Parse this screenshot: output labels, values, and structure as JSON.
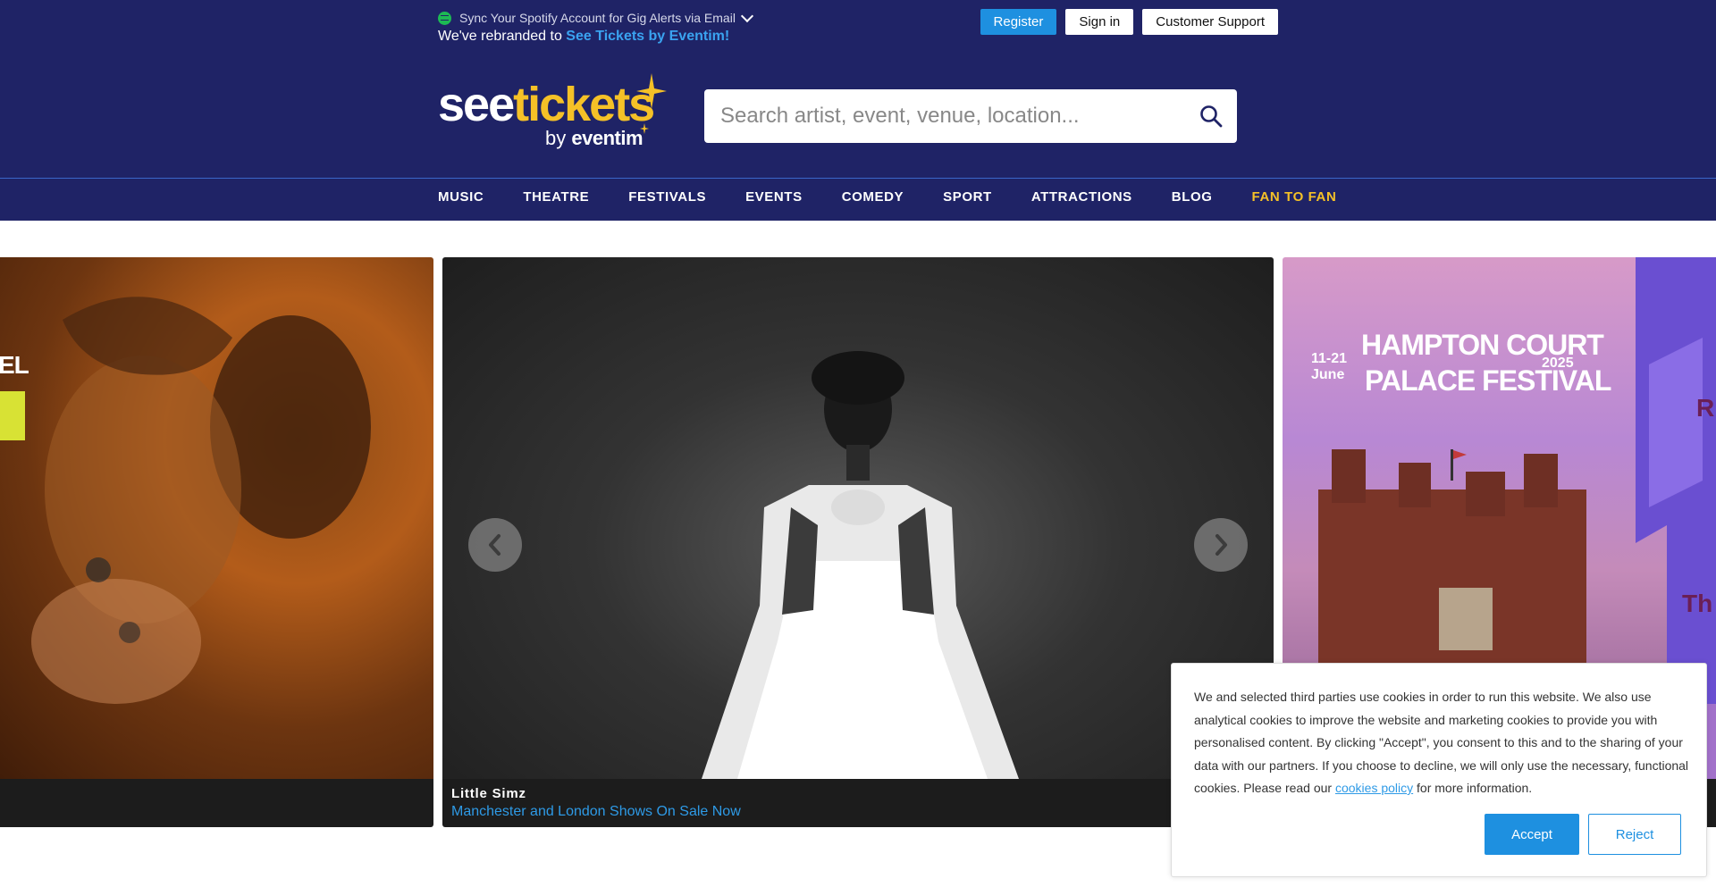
{
  "topbar": {
    "spotify_text": "Sync Your Spotify Account for Gig Alerts via Email",
    "rebrand_prefix": "We've rebranded to ",
    "rebrand_link": "See Tickets by Eventim!",
    "register": "Register",
    "sign_in": "Sign in",
    "support": "Customer Support"
  },
  "logo": {
    "see": "see",
    "tickets": "tickets",
    "by": "by",
    "eventim": "eventim"
  },
  "search": {
    "placeholder": "Search artist, event, venue, location..."
  },
  "nav": {
    "items": [
      "MUSIC",
      "THEATRE",
      "FESTIVALS",
      "EVENTS",
      "COMEDY",
      "SPORT",
      "ATTRACTIONS",
      "BLOG"
    ],
    "fan": "FAN TO FAN"
  },
  "carousel": {
    "center": {
      "title": "Little Simz",
      "subtitle": "Manchester and London Shows On Sale Now"
    },
    "left": {
      "overlay_a": "EL"
    },
    "right": {
      "dates": "11-21\nJune",
      "title_line1": "HAMPTON COURT",
      "title_line2": "PALACE FESTIVAL",
      "year": "2025",
      "edge_r": "R",
      "edge_th": "Th"
    }
  },
  "cookie": {
    "text_before": "We and selected third parties use cookies in order to run this website. We also use analytical cookies to improve the website and marketing cookies to provide you with personalised content. By clicking \"Accept\", you consent to this and to the sharing of your data with our partners. If you choose to decline, we will only use the necessary, functional cookies. Please read our ",
    "policy_link": "cookies policy",
    "text_after": " for more information.",
    "accept": "Accept",
    "reject": "Reject"
  },
  "colors": {
    "header_bg": "#1f2366",
    "accent_blue": "#1e90e0",
    "brand_yellow": "#f5c127"
  }
}
